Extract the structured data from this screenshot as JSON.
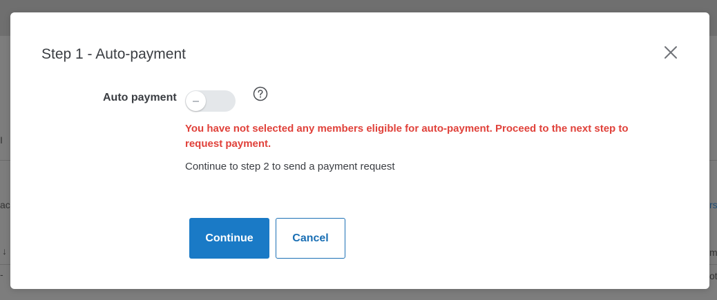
{
  "background": {
    "fragments": [
      "I",
      "ac",
      "rs",
      "↓",
      "m",
      "-",
      "ot"
    ]
  },
  "modal": {
    "title": "Step 1 - Auto-payment",
    "close_icon": "close-icon",
    "auto_payment": {
      "label": "Auto payment",
      "enabled": false,
      "help_icon": "question-circle-icon"
    },
    "warning": "You have not selected any members eligible for auto-payment. Proceed to the next step to request payment.",
    "info": "Continue to step 2 to send a payment request",
    "buttons": {
      "continue_label": "Continue",
      "cancel_label": "Cancel"
    },
    "colors": {
      "primary": "#1a7ac6",
      "warning": "#e0413a",
      "toggle_off": "#e4e7ea"
    }
  }
}
